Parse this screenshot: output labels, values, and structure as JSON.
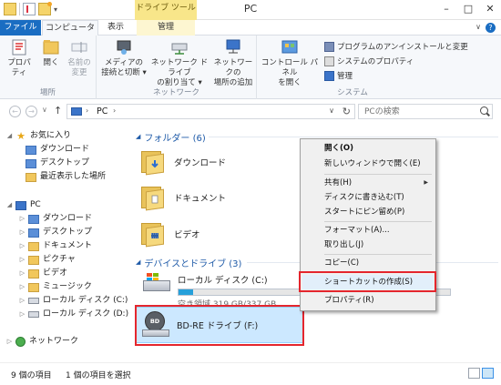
{
  "window": {
    "title": "PC",
    "minimize": "–",
    "maximize": "□",
    "close": "✕"
  },
  "ribbon_tabs": {
    "file": "ファイル",
    "computer": "コンピューター",
    "view": "表示",
    "manage": "管理",
    "context_header": "ドライブ ツール",
    "collapse": "∨",
    "help": "?"
  },
  "ribbon": {
    "location_group": {
      "label": "場所",
      "properties": "プロパティ",
      "open": "開く",
      "rename_line1": "名前の",
      "rename_line2": "変更"
    },
    "network_group": {
      "label": "ネットワーク",
      "media_line1": "メディアの",
      "media_line2": "接続と切断 ▾",
      "map_line1": "ネットワーク ドライブ",
      "map_line2": "の割り当て ▾",
      "addloc_line1": "ネットワークの",
      "addloc_line2": "場所の追加"
    },
    "system_group": {
      "label": "システム",
      "cp_line1": "コントロール パネル",
      "cp_line2": "を開く",
      "uninstall": "プログラムのアンインストールと変更",
      "sysprops": "システムのプロパティ",
      "manage": "管理"
    }
  },
  "address": {
    "back": "←",
    "forward": "→",
    "recent": "∨",
    "up": "↑",
    "sep": "›",
    "location": "PC",
    "dropdown": "∨",
    "refresh": "↻",
    "search_placeholder": "PCの検索"
  },
  "nav": {
    "favorites": "お気に入り",
    "fav_items": [
      "ダウンロード",
      "デスクトップ",
      "最近表示した場所"
    ],
    "pc": "PC",
    "pc_items": [
      "ダウンロード",
      "デスクトップ",
      "ドキュメント",
      "ピクチャ",
      "ビデオ",
      "ミュージック",
      "ローカル ディスク (C:)",
      "ローカル ディスク (D:)"
    ],
    "network": "ネットワーク",
    "expander_open": "◢",
    "expander_closed": "▷"
  },
  "content": {
    "folders_header": "フォルダー (6)",
    "folders": [
      "ダウンロード",
      "ドキュメント",
      "ビデオ"
    ],
    "devices_header": "デバイスとドライブ (3)",
    "local_disk": {
      "name": "ローカル ディスク (C:)",
      "free": "空き領域 319 GB/337 GB",
      "used_fraction": 0.053
    },
    "bd_drive": {
      "name": "BD-RE ドライブ (F:)",
      "disc_text": "BD"
    },
    "chevron": "◢"
  },
  "context_menu": {
    "items": [
      {
        "label": "開く(O)",
        "bold": true
      },
      {
        "label": "新しいウィンドウで開く(E)"
      },
      {
        "label": "共有(H)",
        "submenu": true
      },
      {
        "label": "ディスクに書き込む(T)"
      },
      {
        "label": "スタートにピン留め(P)"
      },
      {
        "label": "フォーマット(A)..."
      },
      {
        "label": "取り出し(J)"
      },
      {
        "label": "コピー(C)"
      },
      {
        "label": "ショートカットの作成(S)",
        "highlighted": true
      },
      {
        "label": "プロパティ(R)"
      }
    ],
    "submenu_arrow": "▶"
  },
  "status": {
    "item_count": "9 個の項目",
    "selected": "1 個の項目を選択"
  },
  "colors": {
    "accent": "#1a6dc2",
    "highlight_frame": "#e4262d",
    "selection": "#cce8ff",
    "progress": "#26a0da"
  }
}
